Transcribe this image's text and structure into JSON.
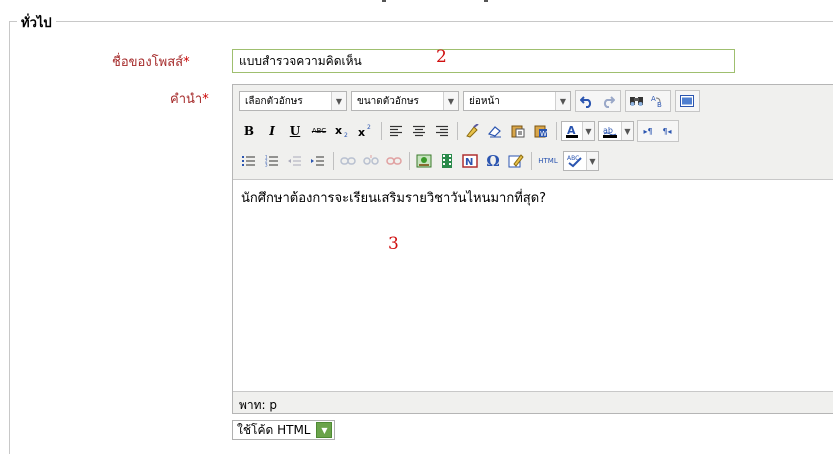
{
  "fieldset": {
    "legend": "ทั่วไป"
  },
  "subject": {
    "label": "ชื่อของโพสส์",
    "required_mark": "*",
    "value": "แบบสำรวจความคิดเห็น"
  },
  "message": {
    "label": "คำนำ",
    "required_mark": "*"
  },
  "annotations": {
    "subject_marker": "2",
    "editor_marker": "3"
  },
  "toolbar": {
    "font_family": "เลือกตัวอักษร",
    "font_size": "ขนาดตัวอักษร",
    "paragraph": "ย่อหน้า",
    "icons_row1": [
      "undo-icon",
      "redo-icon",
      "find-icon",
      "replace-icon",
      "fullscreen-icon"
    ],
    "icons_row2": [
      "bold-icon",
      "italic-icon",
      "underline-icon",
      "strikethrough-icon",
      "subscript-icon",
      "superscript-icon",
      "align-left-icon",
      "align-center-icon",
      "align-right-icon",
      "cleanup-icon",
      "remove-format-icon",
      "paste-text-icon",
      "paste-word-icon",
      "text-color-icon",
      "background-color-icon",
      "ltr-icon",
      "rtl-icon"
    ],
    "icons_row3": [
      "bullet-list-icon",
      "numbered-list-icon",
      "outdent-icon",
      "indent-icon",
      "link-icon",
      "unlink-icon",
      "anchor-icon",
      "image-icon",
      "media-icon",
      "nonbreaking-icon",
      "special-char-icon",
      "edit-icon",
      "html-source-icon",
      "spellcheck-icon"
    ],
    "bold_label": "B",
    "italic_label": "I",
    "underline_label": "U",
    "strike_label": "ABC",
    "html_label": "HTML",
    "abc_label": "ABC",
    "omega_label": "Ω",
    "ltr_label": "▸¶",
    "rtl_label": "¶◂"
  },
  "editor": {
    "content": "นักศึกษาต้องการจะเรียนเสริมรายวิชาวันไหนมากที่สุด?",
    "path": "พาท: p"
  },
  "format": {
    "selected": "ใช้โค้ด HTML"
  },
  "colors": {
    "label": "#a52a2a",
    "required": "#cc0000",
    "input_border": "#9fbf6f",
    "annotation": "#d01010",
    "select_arrow": "#6aa34a"
  }
}
